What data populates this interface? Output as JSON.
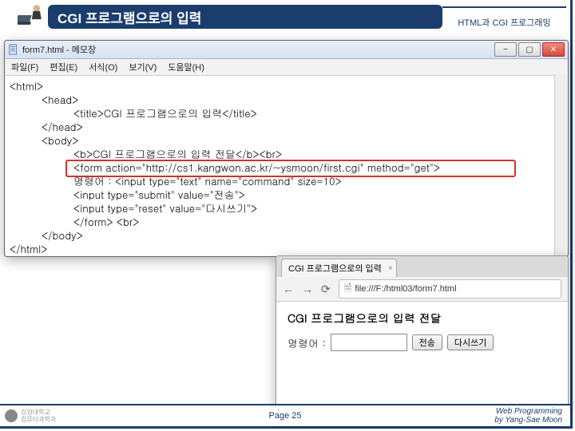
{
  "slide": {
    "title": "CGI 프로그램으로의 입력",
    "subtitle": "HTML과 CGI 프로그래밍"
  },
  "notepad": {
    "title": "form7.html - 메모장",
    "menus": [
      "파일(F)",
      "편집(E)",
      "서식(O)",
      "보기(V)",
      "도움말(H)"
    ],
    "code": {
      "l1": "<html>",
      "l2": "<head>",
      "l3": "<title>CGI 프로그램으로의 입력</title>",
      "l4": "</head>",
      "l5": "<body>",
      "l6": "<b>CGI 프로그램으로의 입력 전달</b><br>",
      "l7": "<form action=\"http://cs1.kangwon.ac.kr/~ysmoon/first.cgi\" method=\"get\">",
      "l8": "명령어 : <input type=\"text\" name=\"command\" size=10>",
      "l9": "<input type=\"submit\" value=\"전송\">",
      "l10": "<input type=\"reset\" value=\"다시쓰기\">",
      "l11": "</form> <br>",
      "l12": "</body>",
      "l13": "</html>"
    }
  },
  "browser": {
    "tab_title": "CGI 프로그램으로의 입력",
    "url": "file:///F:/html03/form7.html",
    "page_title": "CGI 프로그램으로의 입력 전달",
    "label": "명령어 :",
    "submit_label": "전송",
    "reset_label": "다시쓰기"
  },
  "footer": {
    "page": "Page 25",
    "credit1": "Web Programming",
    "credit2": "by Yang-Sae Moon",
    "univ1": "강원대학교",
    "univ2": "컴퓨터과학과"
  }
}
